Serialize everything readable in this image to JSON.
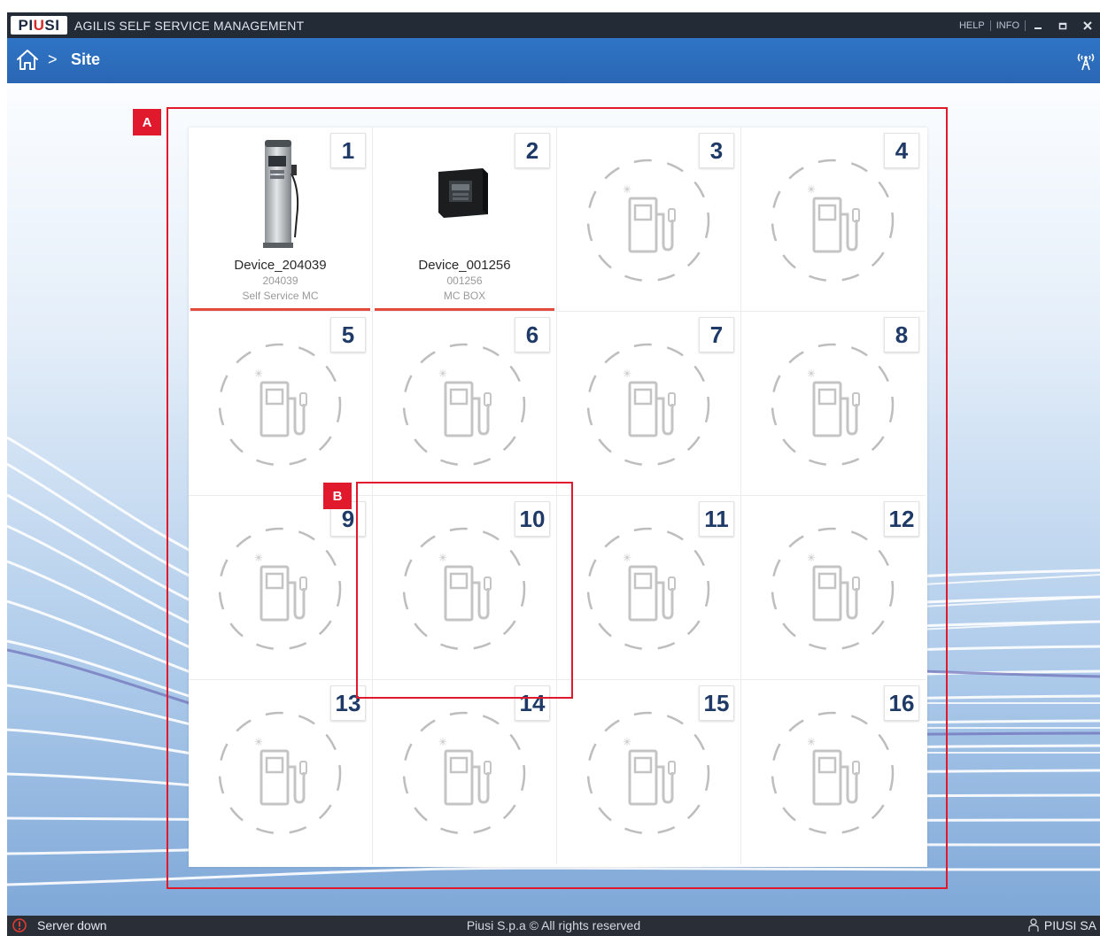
{
  "app": {
    "logo": {
      "l1": "PI",
      "l2": "U",
      "l3": "SI"
    },
    "title": "AGILIS SELF SERVICE MANAGEMENT",
    "help": "HELP",
    "info": "INFO"
  },
  "nav": {
    "separator": ">",
    "breadcrumb": "Site"
  },
  "cells": [
    {
      "number": "1",
      "device_name": "Device_204039",
      "device_id": "204039",
      "device_type": "Self Service MC",
      "image": "fuel-dispenser"
    },
    {
      "number": "2",
      "device_name": "Device_001256",
      "device_id": "001256",
      "device_type": "MC BOX",
      "image": "mc-box"
    },
    {
      "number": "3",
      "image": "empty-pump"
    },
    {
      "number": "4",
      "image": "empty-pump"
    },
    {
      "number": "5",
      "image": "empty-pump"
    },
    {
      "number": "6",
      "image": "empty-pump"
    },
    {
      "number": "7",
      "image": "empty-pump"
    },
    {
      "number": "8",
      "image": "empty-pump"
    },
    {
      "number": "9",
      "image": "empty-pump"
    },
    {
      "number": "10",
      "image": "empty-pump"
    },
    {
      "number": "11",
      "image": "empty-pump"
    },
    {
      "number": "12",
      "image": "empty-pump"
    },
    {
      "number": "13",
      "image": "empty-pump"
    },
    {
      "number": "14",
      "image": "empty-pump"
    },
    {
      "number": "15",
      "image": "empty-pump"
    },
    {
      "number": "16",
      "image": "empty-pump"
    }
  ],
  "annotations": {
    "a": "A",
    "b": "B"
  },
  "status": {
    "server": "Server down",
    "copyright": "Piusi S.p.a © All rights reserved",
    "user": "PIUSI SA"
  },
  "colors": {
    "accent": "#2f74c6",
    "device_line": "#e24a3d",
    "annotation": "#e0192c",
    "number": "#203a67"
  }
}
